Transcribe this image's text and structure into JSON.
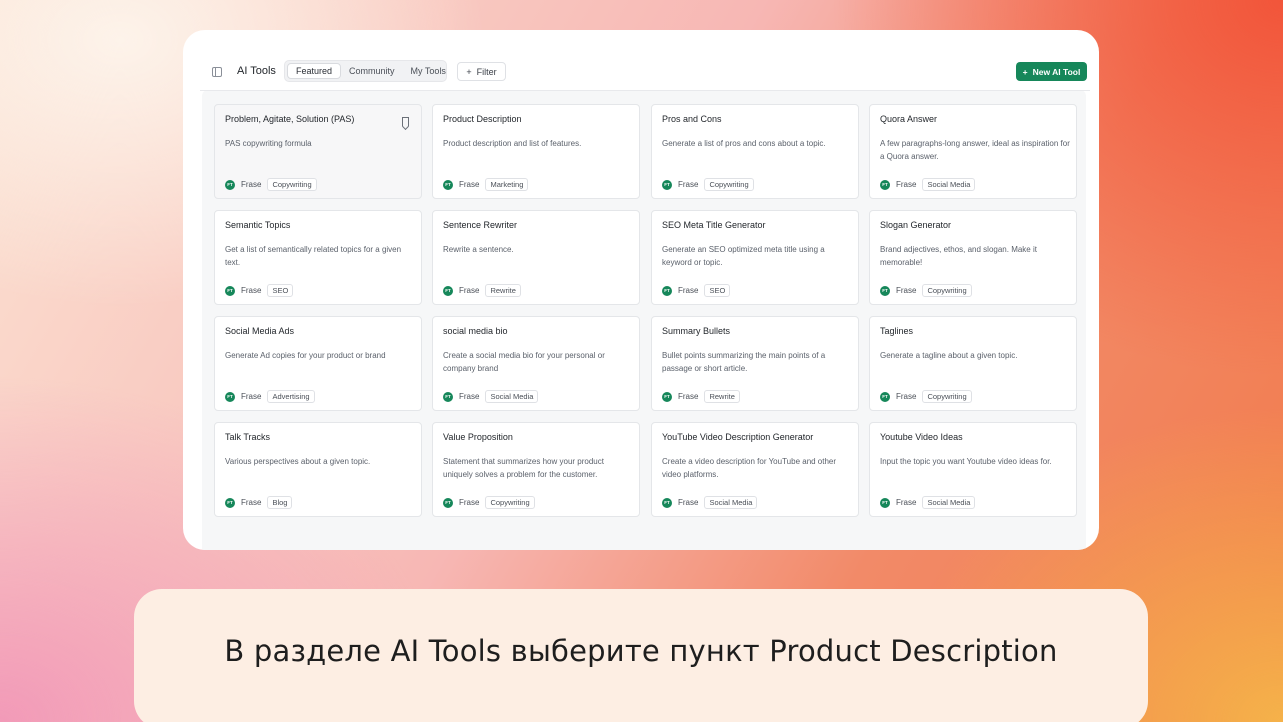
{
  "header": {
    "title": "AI Tools",
    "tabs": [
      "Featured",
      "Community",
      "My Tools"
    ],
    "active_tab": "Featured",
    "filter_label": "Filter",
    "new_tool_label": "New AI Tool"
  },
  "colors": {
    "accent": "#16875a",
    "caption_bg": "#fdeee3"
  },
  "cards": [
    {
      "title": "Problem, Agitate, Solution (PAS)",
      "desc": "PAS copywriting formula",
      "author": "Frase",
      "tag": "Copywriting",
      "bookmark": true
    },
    {
      "title": "Product Description",
      "desc": "Product description and list of features.",
      "author": "Frase",
      "tag": "Marketing"
    },
    {
      "title": "Pros and Cons",
      "desc": "Generate a list of pros and cons about a topic.",
      "author": "Frase",
      "tag": "Copywriting"
    },
    {
      "title": "Quora Answer",
      "desc": "A few paragraphs-long answer, ideal as inspiration for a Quora answer.",
      "author": "Frase",
      "tag": "Social Media"
    },
    {
      "title": "Semantic Topics",
      "desc": "Get a list of semantically related topics for a given text.",
      "author": "Frase",
      "tag": "SEO"
    },
    {
      "title": "Sentence Rewriter",
      "desc": "Rewrite a sentence.",
      "author": "Frase",
      "tag": "Rewrite"
    },
    {
      "title": "SEO Meta Title Generator",
      "desc": "Generate an SEO optimized meta title using a keyword or topic.",
      "author": "Frase",
      "tag": "SEO"
    },
    {
      "title": "Slogan Generator",
      "desc": "Brand adjectives, ethos, and slogan. Make it memorable!",
      "author": "Frase",
      "tag": "Copywriting"
    },
    {
      "title": "Social Media Ads",
      "desc": "Generate Ad copies for your product or brand",
      "author": "Frase",
      "tag": "Advertising"
    },
    {
      "title": "social media bio",
      "desc": "Create a social media bio for your personal or company brand",
      "author": "Frase",
      "tag": "Social Media"
    },
    {
      "title": "Summary Bullets",
      "desc": "Bullet points summarizing the main points of a passage or short article.",
      "author": "Frase",
      "tag": "Rewrite"
    },
    {
      "title": "Taglines",
      "desc": "Generate a tagline about a given topic.",
      "author": "Frase",
      "tag": "Copywriting"
    },
    {
      "title": "Talk Tracks",
      "desc": "Various perspectives about a given topic.",
      "author": "Frase",
      "tag": "Blog"
    },
    {
      "title": "Value Proposition",
      "desc": "Statement that summarizes how your product uniquely solves a problem for the customer.",
      "author": "Frase",
      "tag": "Copywriting"
    },
    {
      "title": "YouTube Video Description Generator",
      "desc": "Create a video description for YouTube and other video platforms.",
      "author": "Frase",
      "tag": "Social Media"
    },
    {
      "title": "Youtube Video Ideas",
      "desc": "Input the topic you want Youtube video ideas for.",
      "author": "Frase",
      "tag": "Social Media"
    }
  ],
  "caption": "В разделе AI Tools выберите пункт Product Description"
}
